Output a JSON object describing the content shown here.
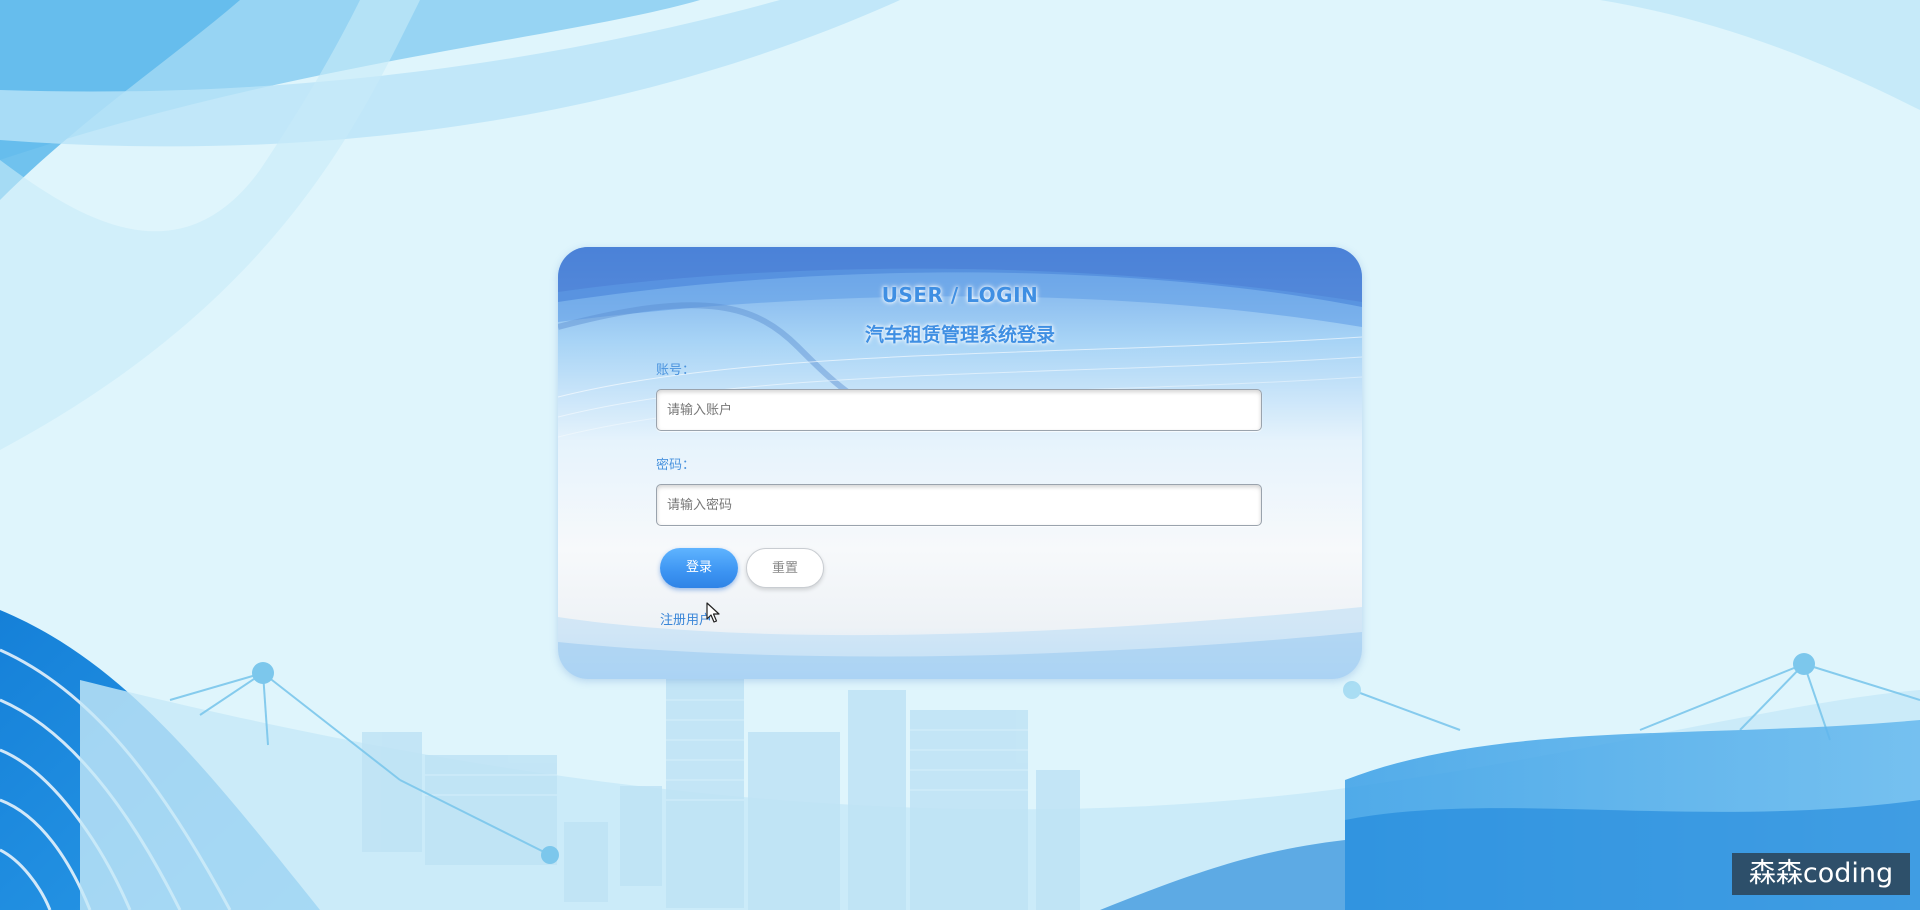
{
  "login": {
    "title_en": "USER / LOGIN",
    "title_cn": "汽车租赁管理系统登录",
    "account_label": "账号：",
    "account_placeholder": "请输入账户",
    "password_label": "密码：",
    "password_placeholder": "请输入密码",
    "login_button": "登录",
    "reset_button": "重置",
    "register_link": "注册用户"
  },
  "watermark": "森森coding",
  "colors": {
    "accent": "#3f8fe3",
    "button_primary": "#3c94f2",
    "background": "#dff5fc"
  }
}
